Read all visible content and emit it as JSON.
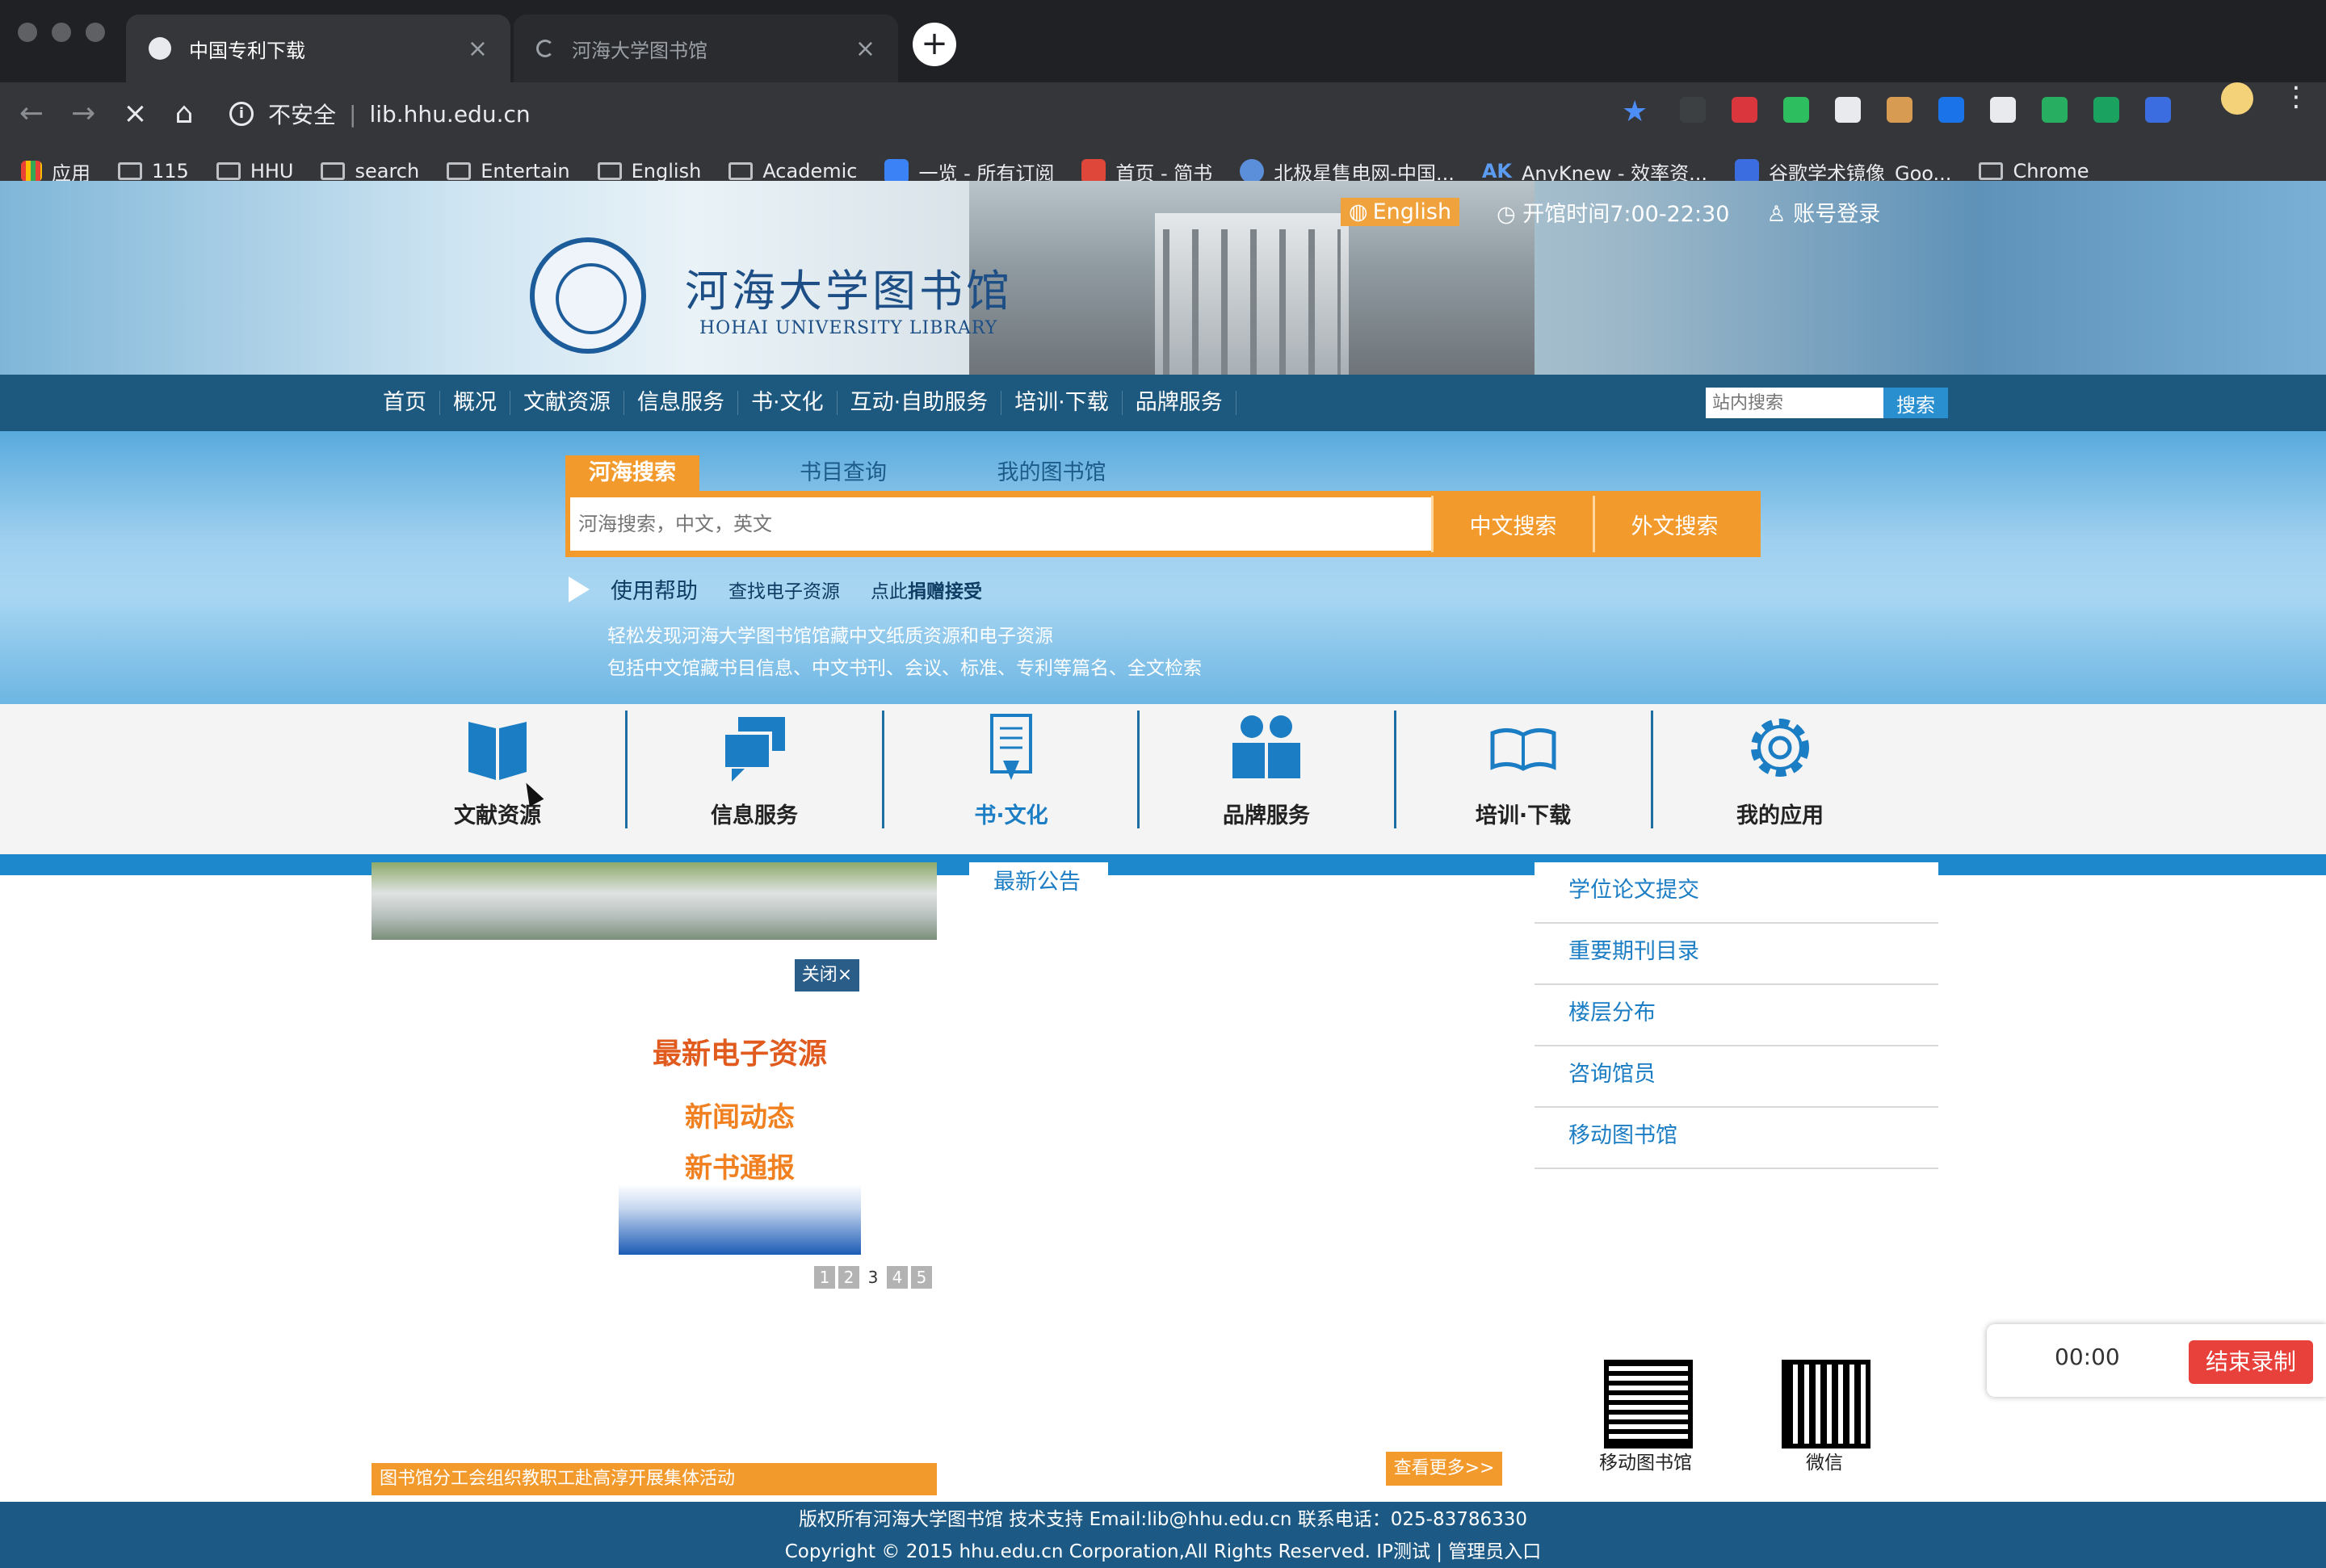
{
  "browser": {
    "tabs": [
      {
        "title": "中国专利下载",
        "active": true
      },
      {
        "title": "河海大学图书馆",
        "active": false
      }
    ],
    "security_label": "不安全",
    "url": "lib.hhu.edu.cn",
    "bookmarks": [
      "应用",
      "115",
      "HHU",
      "search",
      "Entertain",
      "English",
      "Academic",
      "一览 - 所有订阅",
      "首页 - 简书",
      "北极星售电网-中国...",
      "AnyKnew - 效率资...",
      "谷歌学术镜像_Goo...",
      "Chrome"
    ],
    "bookmark_ak": "AK"
  },
  "header": {
    "site_name": "河海大学图书馆",
    "site_name_en": "HOHAI UNIVERSITY LIBRARY",
    "english": "English",
    "hours": "开馆时间7:00-22:30",
    "login": "账号登录"
  },
  "nav": {
    "items": [
      "首页",
      "概况",
      "文献资源",
      "信息服务",
      "书·文化",
      "互动·自助服务",
      "培训·下载",
      "品牌服务"
    ],
    "search_placeholder": "站内搜索",
    "search_button": "搜索"
  },
  "search": {
    "tabs": [
      "河海搜索",
      "书目查询",
      "我的图书馆"
    ],
    "placeholder": "河海搜索，中文，英文",
    "btn_cn": "中文搜索",
    "btn_foreign": "外文搜索",
    "help": "使用帮助",
    "find_eres": "查找电子资源",
    "donate_prefix": "点此",
    "donate": "捐赠接受",
    "desc1": "轻松发现河海大学图书馆馆藏中文纸质资源和电子资源",
    "desc2": "包括中文馆藏书目信息、中文书刊、会议、标准、专利等篇名、全文检索"
  },
  "icons": [
    {
      "label": "文献资源",
      "icon": "book-icon"
    },
    {
      "label": "信息服务",
      "icon": "chat-icon"
    },
    {
      "label": "书·文化",
      "icon": "document-icon"
    },
    {
      "label": "品牌服务",
      "icon": "people-icon"
    },
    {
      "label": "培训·下载",
      "icon": "open-book-icon"
    },
    {
      "label": "我的应用",
      "icon": "gear-icon"
    }
  ],
  "content": {
    "close": "关闭×",
    "promo1": "最新电子资源",
    "promo2": "新闻动态",
    "promo3": "新书通报",
    "pages": [
      "1",
      "2",
      "3",
      "4",
      "5"
    ],
    "current_page": "3",
    "caption": "图书馆分工会组织教职工赴高淳开展集体活动",
    "notice_title": "最新公告",
    "more": "查看更多>>",
    "quick_links": [
      "学位论文提交",
      "重要期刊目录",
      "楼层分布",
      "咨询馆员",
      "移动图书馆"
    ],
    "qr1": "移动图书馆",
    "qr2": "微信"
  },
  "footer": {
    "line1": "版权所有河海大学图书馆 技术支持 Email:lib@hhu.edu.cn 联系电话：025-83786330",
    "line2": "Copyright © 2015 hhu.edu.cn Corporation,All Rights Reserved. IP测试 | 管理员入口"
  },
  "recorder": {
    "time": "00:00",
    "stop": "结束录制"
  },
  "colors": {
    "orange": "#f39a2d",
    "nav": "#1d587e",
    "accent": "#1b7dc4"
  }
}
